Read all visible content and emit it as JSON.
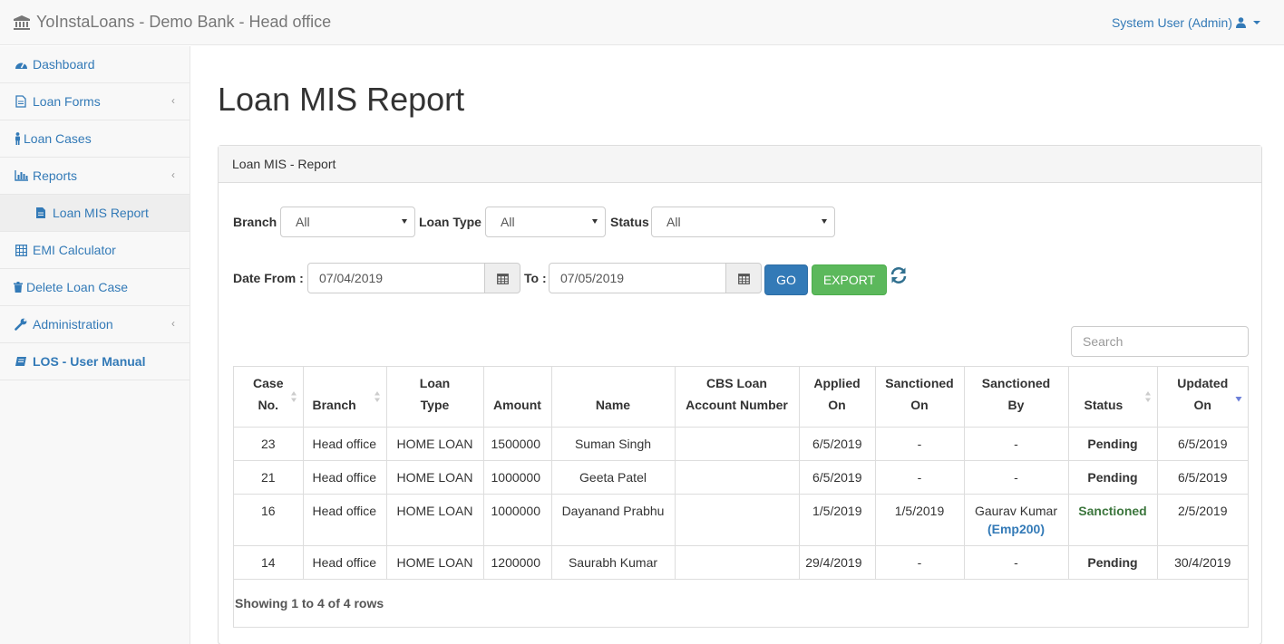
{
  "header": {
    "brand": "YoInstaLoans - Demo Bank - Head office",
    "user": "System User (Admin)"
  },
  "sidebar": {
    "items": [
      {
        "label": "Dashboard",
        "icon": "dashboard-icon"
      },
      {
        "label": "Loan Forms",
        "icon": "file-icon"
      },
      {
        "label": "Loan Cases",
        "icon": "person-icon"
      },
      {
        "label": "Reports",
        "icon": "bar-chart-icon"
      },
      {
        "label": "Loan MIS Report",
        "icon": "file-icon"
      },
      {
        "label": "EMI Calculator",
        "icon": "calculator-icon"
      },
      {
        "label": "Delete Loan Case",
        "icon": "trash-icon"
      },
      {
        "label": "Administration",
        "icon": "wrench-icon"
      },
      {
        "label": "LOS - User Manual",
        "icon": "book-icon"
      }
    ]
  },
  "page": {
    "title": "Loan MIS Report",
    "panel_title": "Loan MIS - Report"
  },
  "filters": {
    "branch_label": "Branch",
    "branch_value": "All",
    "loan_type_label": "Loan Type",
    "loan_type_value": "All",
    "status_label": "Status",
    "status_value": "All",
    "date_from_label": "Date From :",
    "date_from_value": "07/04/2019",
    "to_label": "To :",
    "to_value": "07/05/2019",
    "go_label": "GO",
    "export_label": "EXPORT",
    "search_placeholder": "Search"
  },
  "table": {
    "columns": [
      {
        "line1": "Case",
        "line2": "No."
      },
      {
        "line1": "",
        "line2": "Branch"
      },
      {
        "line1": "Loan",
        "line2": "Type"
      },
      {
        "line1": "",
        "line2": "Amount"
      },
      {
        "line1": "",
        "line2": "Name"
      },
      {
        "line1": "CBS Loan",
        "line2": "Account Number"
      },
      {
        "line1": "Applied",
        "line2": "On"
      },
      {
        "line1": "Sanctioned",
        "line2": "On"
      },
      {
        "line1": "Sanctioned",
        "line2": "By"
      },
      {
        "line1": "",
        "line2": "Status"
      },
      {
        "line1": "Updated",
        "line2": "On"
      }
    ],
    "rows": [
      {
        "case_no": "23",
        "branch": "Head office",
        "loan_type": "HOME LOAN",
        "amount": "1500000",
        "name": "Suman Singh",
        "cbs": "",
        "applied_on": "6/5/2019",
        "sanctioned_on": "-",
        "sanctioned_by": "-",
        "sanctioned_by_emp": "",
        "status": "Pending",
        "updated_on": "6/5/2019"
      },
      {
        "case_no": "21",
        "branch": "Head office",
        "loan_type": "HOME LOAN",
        "amount": "1000000",
        "name": "Geeta Patel",
        "cbs": "",
        "applied_on": "6/5/2019",
        "sanctioned_on": "-",
        "sanctioned_by": "-",
        "sanctioned_by_emp": "",
        "status": "Pending",
        "updated_on": "6/5/2019"
      },
      {
        "case_no": "16",
        "branch": "Head office",
        "loan_type": "HOME LOAN",
        "amount": "1000000",
        "name": "Dayanand Prabhu",
        "cbs": "",
        "applied_on": "1/5/2019",
        "sanctioned_on": "1/5/2019",
        "sanctioned_by": "Gaurav Kumar",
        "sanctioned_by_emp": "(Emp200)",
        "status": "Sanctioned",
        "updated_on": "2/5/2019"
      },
      {
        "case_no": "14",
        "branch": "Head office",
        "loan_type": "HOME LOAN",
        "amount": "1200000",
        "name": "Saurabh Kumar",
        "cbs": "",
        "applied_on": "29/4/2019",
        "sanctioned_on": "-",
        "sanctioned_by": "-",
        "sanctioned_by_emp": "",
        "status": "Pending",
        "updated_on": "30/4/2019"
      }
    ],
    "footer": "Showing 1 to 4 of 4 rows"
  },
  "colors": {
    "link": "#337ab7",
    "sanctioned": "#3c763d",
    "go_button": "#337ab7",
    "export_button": "#5cb85c"
  }
}
